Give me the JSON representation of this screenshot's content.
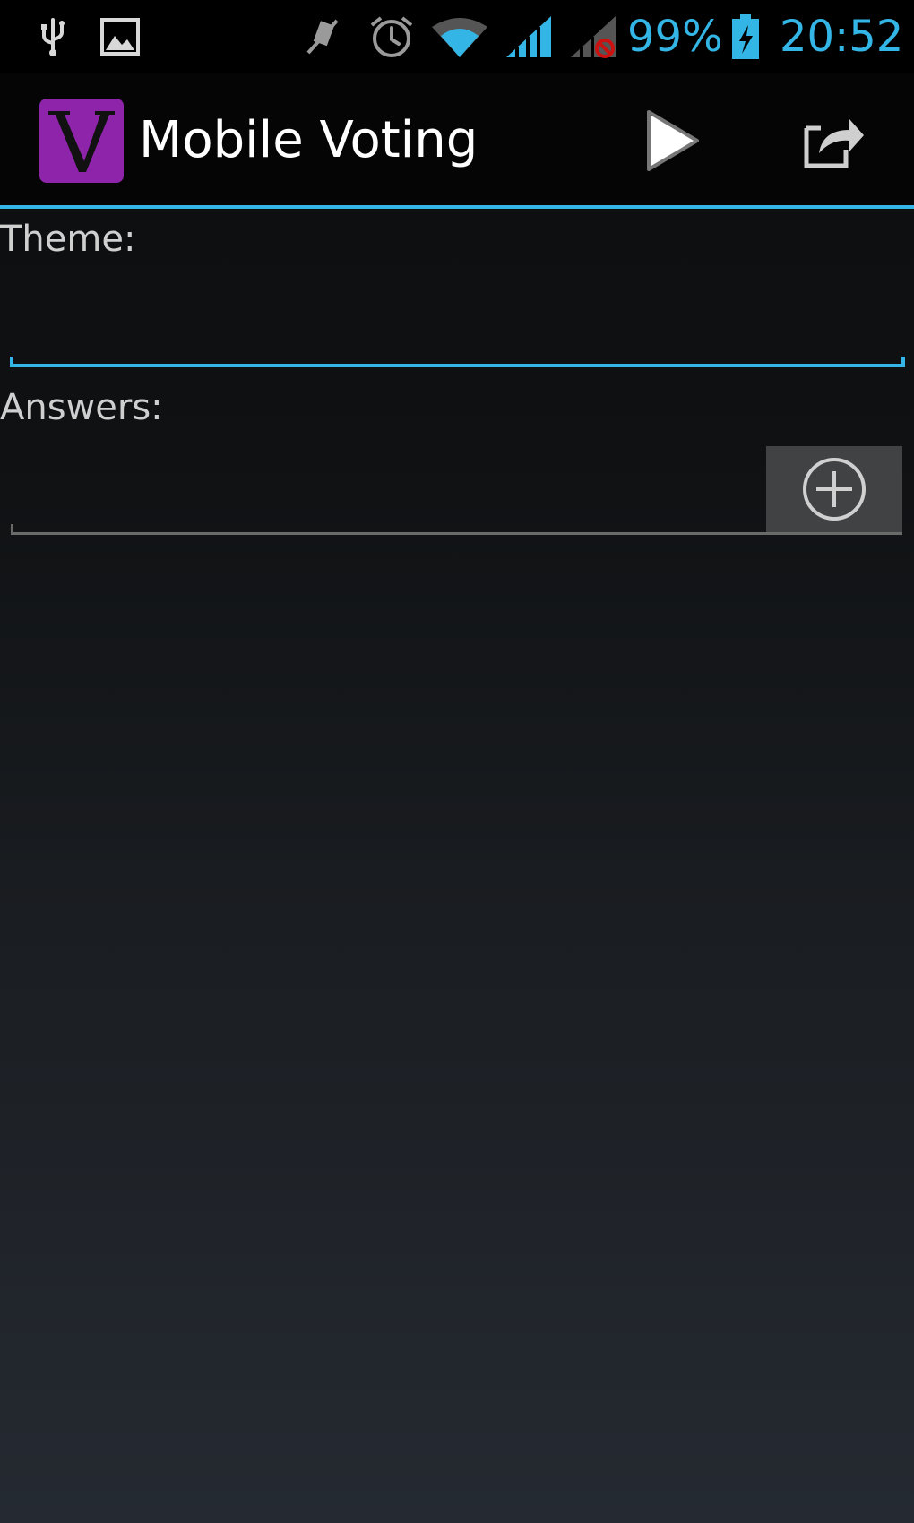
{
  "status_bar": {
    "battery_percent": "99%",
    "time": "20:52",
    "accent_color": "#33b5e5",
    "icons": [
      "usb-icon",
      "gallery-icon",
      "muted-icon",
      "alarm-icon",
      "wifi-icon",
      "signal-icon",
      "signal-no-sim-icon",
      "battery-charging-icon"
    ]
  },
  "action_bar": {
    "title": "Mobile Voting",
    "logo_letter": "V",
    "logo_color": "#8e24aa",
    "actions": [
      "play-icon",
      "share-icon"
    ]
  },
  "form": {
    "theme_label": "Theme:",
    "theme_value": "",
    "answers_label": "Answers:",
    "answer_value": "",
    "add_button_icon": "add-circle-icon"
  }
}
